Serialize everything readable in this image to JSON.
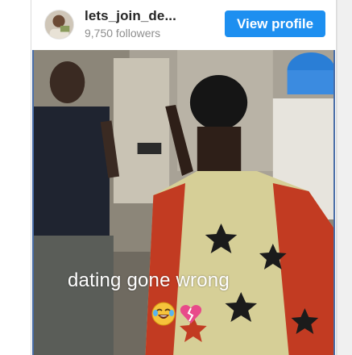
{
  "profile": {
    "username": "lets_join_de...",
    "followers": "9,750 followers",
    "view_profile_label": "View profile",
    "accent_color": "#1d8ff0"
  },
  "media": {
    "caption": "dating gone wrong",
    "emojis": [
      "joy-emoji",
      "broken-heart-emoji"
    ]
  }
}
